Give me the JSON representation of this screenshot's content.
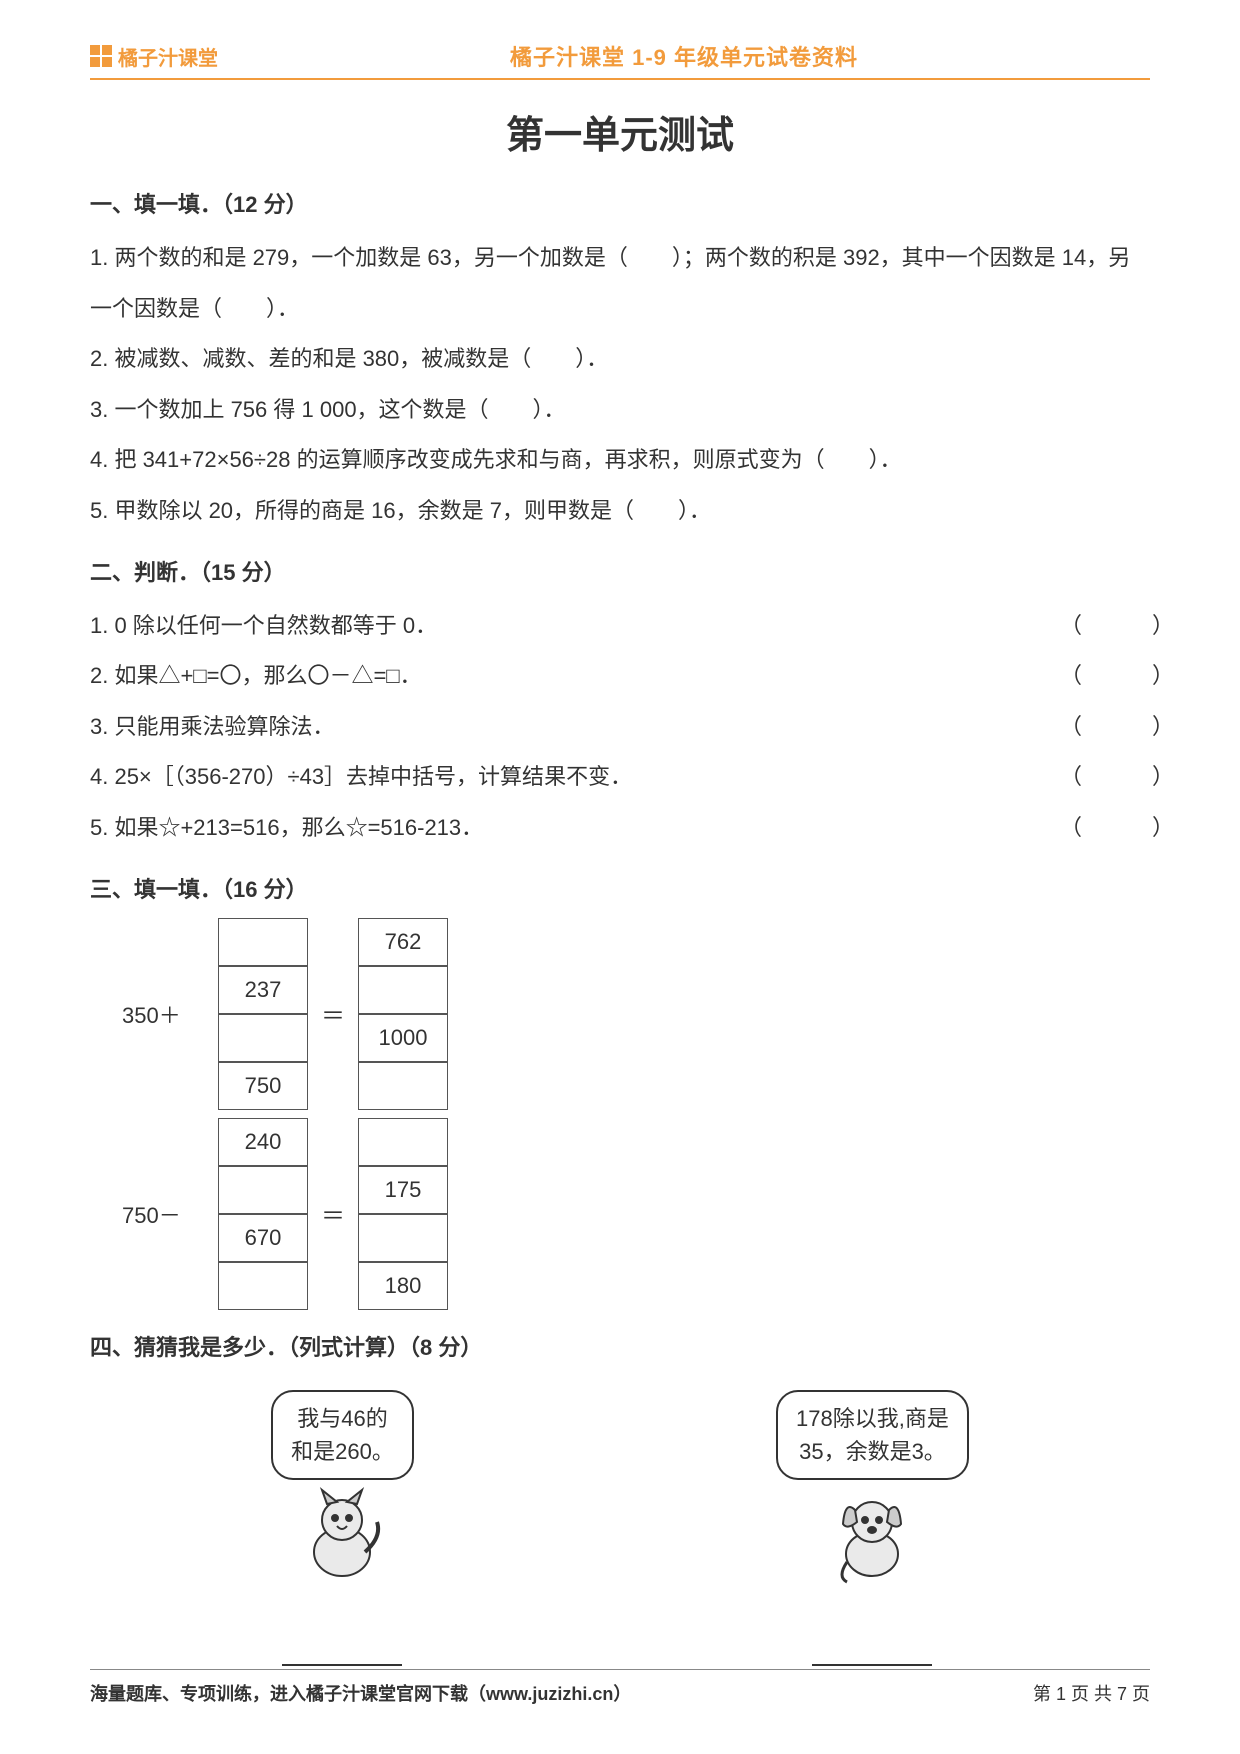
{
  "header": {
    "logo_text": "橘子汁课堂",
    "center_text": "橘子汁课堂 1-9 年级单元试卷资料"
  },
  "title": "第一单元测试",
  "section1": {
    "heading": "一、填一填．（12 分）",
    "q1": "1. 两个数的和是 279，一个加数是 63，另一个加数是（　　）；两个数的积是 392，其中一个因数是 14，另一个因数是（　　）．",
    "q2": "2. 被减数、减数、差的和是 380，被减数是（　　）．",
    "q3": "3. 一个数加上 756 得 1 000，这个数是（　　）．",
    "q4": "4. 把 341+72×56÷28 的运算顺序改变成先求和与商，再求积，则原式变为（　　）．",
    "q5": "5. 甲数除以 20，所得的商是 16，余数是 7，则甲数是（　　）．"
  },
  "section2": {
    "heading": "二、判断．（15 分）",
    "items": [
      "1. 0 除以任何一个自然数都等于 0．",
      "2. 如果△+□=〇，那么〇－△=□．",
      "3. 只能用乘法验算除法．",
      "4. 25×［（356-270）÷43］去掉中括号，计算结果不变．",
      "5. 如果☆+213=516，那么☆=516-213．"
    ],
    "paren": "（　）"
  },
  "section3": {
    "heading": "三、填一填．（16 分）",
    "labels": {
      "a": "350＋",
      "b": "750－",
      "eq": "＝"
    },
    "group1": {
      "left": [
        "",
        "237",
        "",
        "750"
      ],
      "right": [
        "762",
        "",
        "1000",
        ""
      ]
    },
    "group2": {
      "left": [
        "240",
        "",
        "670",
        ""
      ],
      "right": [
        "",
        "175",
        "",
        "180"
      ]
    }
  },
  "section4": {
    "heading": "四、猜猜我是多少．（列式计算）（8 分）",
    "bubble1_line1": "我与46的",
    "bubble1_line2": "和是260。",
    "bubble2_line1": "178除以我,商是",
    "bubble2_line2": "35，余数是3。"
  },
  "footer": {
    "left": "海量题库、专项训练，进入橘子汁课堂官网下载（www.juzizhi.cn）",
    "right": "第 1 页 共 7 页"
  }
}
